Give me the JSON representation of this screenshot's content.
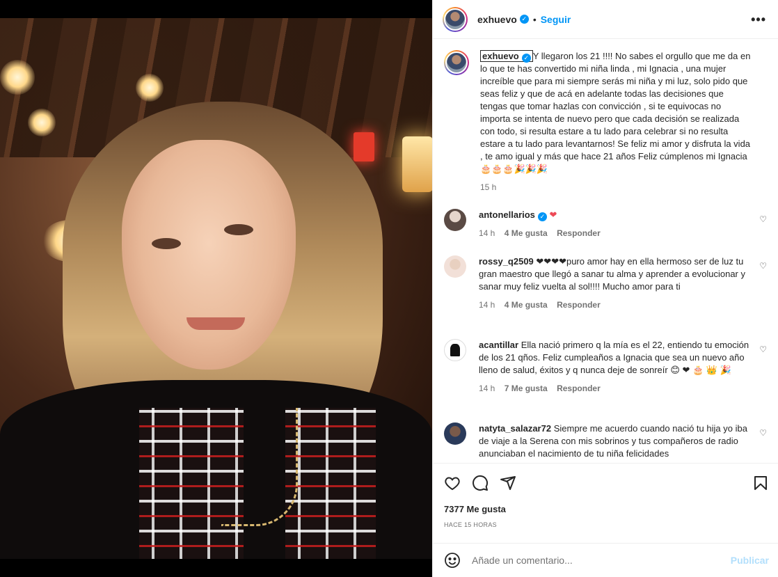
{
  "post": {
    "username": "exhuevo",
    "follow_label": "Seguir",
    "dot": "•",
    "more_label": "•••",
    "caption": "Y llegaron los 21 !!!! No sabes el orgullo que me da en lo que te has convertido mi niña linda , mi Ignacia , una mujer increíble que para mi siempre serás mi niña y mi luz, solo pido que seas feliz y que de acá en adelante todas las decisiones que tengas que tomar hazlas con convicción , si te equivocas no importa se intenta de nuevo pero que cada decisión se realizada con todo, si resulta estare a tu lado para celebrar si no resulta estare a tu lado para levantarnos! Se feliz mi amor y disfruta la vida , te amo igual y más que hace 21 años Feliz cúmplenos mi Ignacia 🎂🎂🎂🎉🎉🎉",
    "caption_time": "15 h",
    "likes": "7377 Me gusta",
    "posted_ago": "HACE 15 HORAS"
  },
  "comments": [
    {
      "username": "antonellarios",
      "verified": true,
      "text": "❤",
      "time": "14 h",
      "likes": "4 Me gusta",
      "reply": "Responder"
    },
    {
      "username": "rossy_q2509",
      "verified": false,
      "text": "❤❤❤❤puro amor hay en ella hermoso ser de luz tu gran maestro que llegó a sanar tu alma y aprender a evolucionar y sanar muy feliz vuelta al sol!!!! Mucho amor para ti",
      "time": "14 h",
      "likes": "4 Me gusta",
      "reply": "Responder"
    },
    {
      "username": "acantillar",
      "verified": false,
      "text": "Ella nació primero q la mía es el 22, entiendo tu emoción de los 21 qños. Feliz cumpleaños a Ignacia que sea un nuevo año lleno de salud, éxitos y q nunca deje de sonreír 😊 ❤ 🎂 👑 🎉",
      "time": "14 h",
      "likes": "7 Me gusta",
      "reply": "Responder"
    },
    {
      "username": "natyta_salazar72",
      "verified": false,
      "text": "Siempre me acuerdo cuando nació tu hija yo iba de viaje a la Serena con mis sobrinos y tus compañeros de radio anunciaban el nacimiento de tu niña felicidades",
      "time": "",
      "likes": "",
      "reply": ""
    }
  ],
  "add_comment": {
    "placeholder": "Añade un comentario...",
    "publish_label": "Publicar"
  },
  "icons": {
    "heart": "heart-icon",
    "comment": "comment-icon",
    "share": "share-icon",
    "save": "bookmark-icon",
    "emoji": "emoji-icon",
    "verified": "verified-icon"
  },
  "colors": {
    "accent": "#0095f6",
    "publish_disabled": "#b2dffc",
    "like_red": "#ed4956",
    "muted": "#737373"
  }
}
